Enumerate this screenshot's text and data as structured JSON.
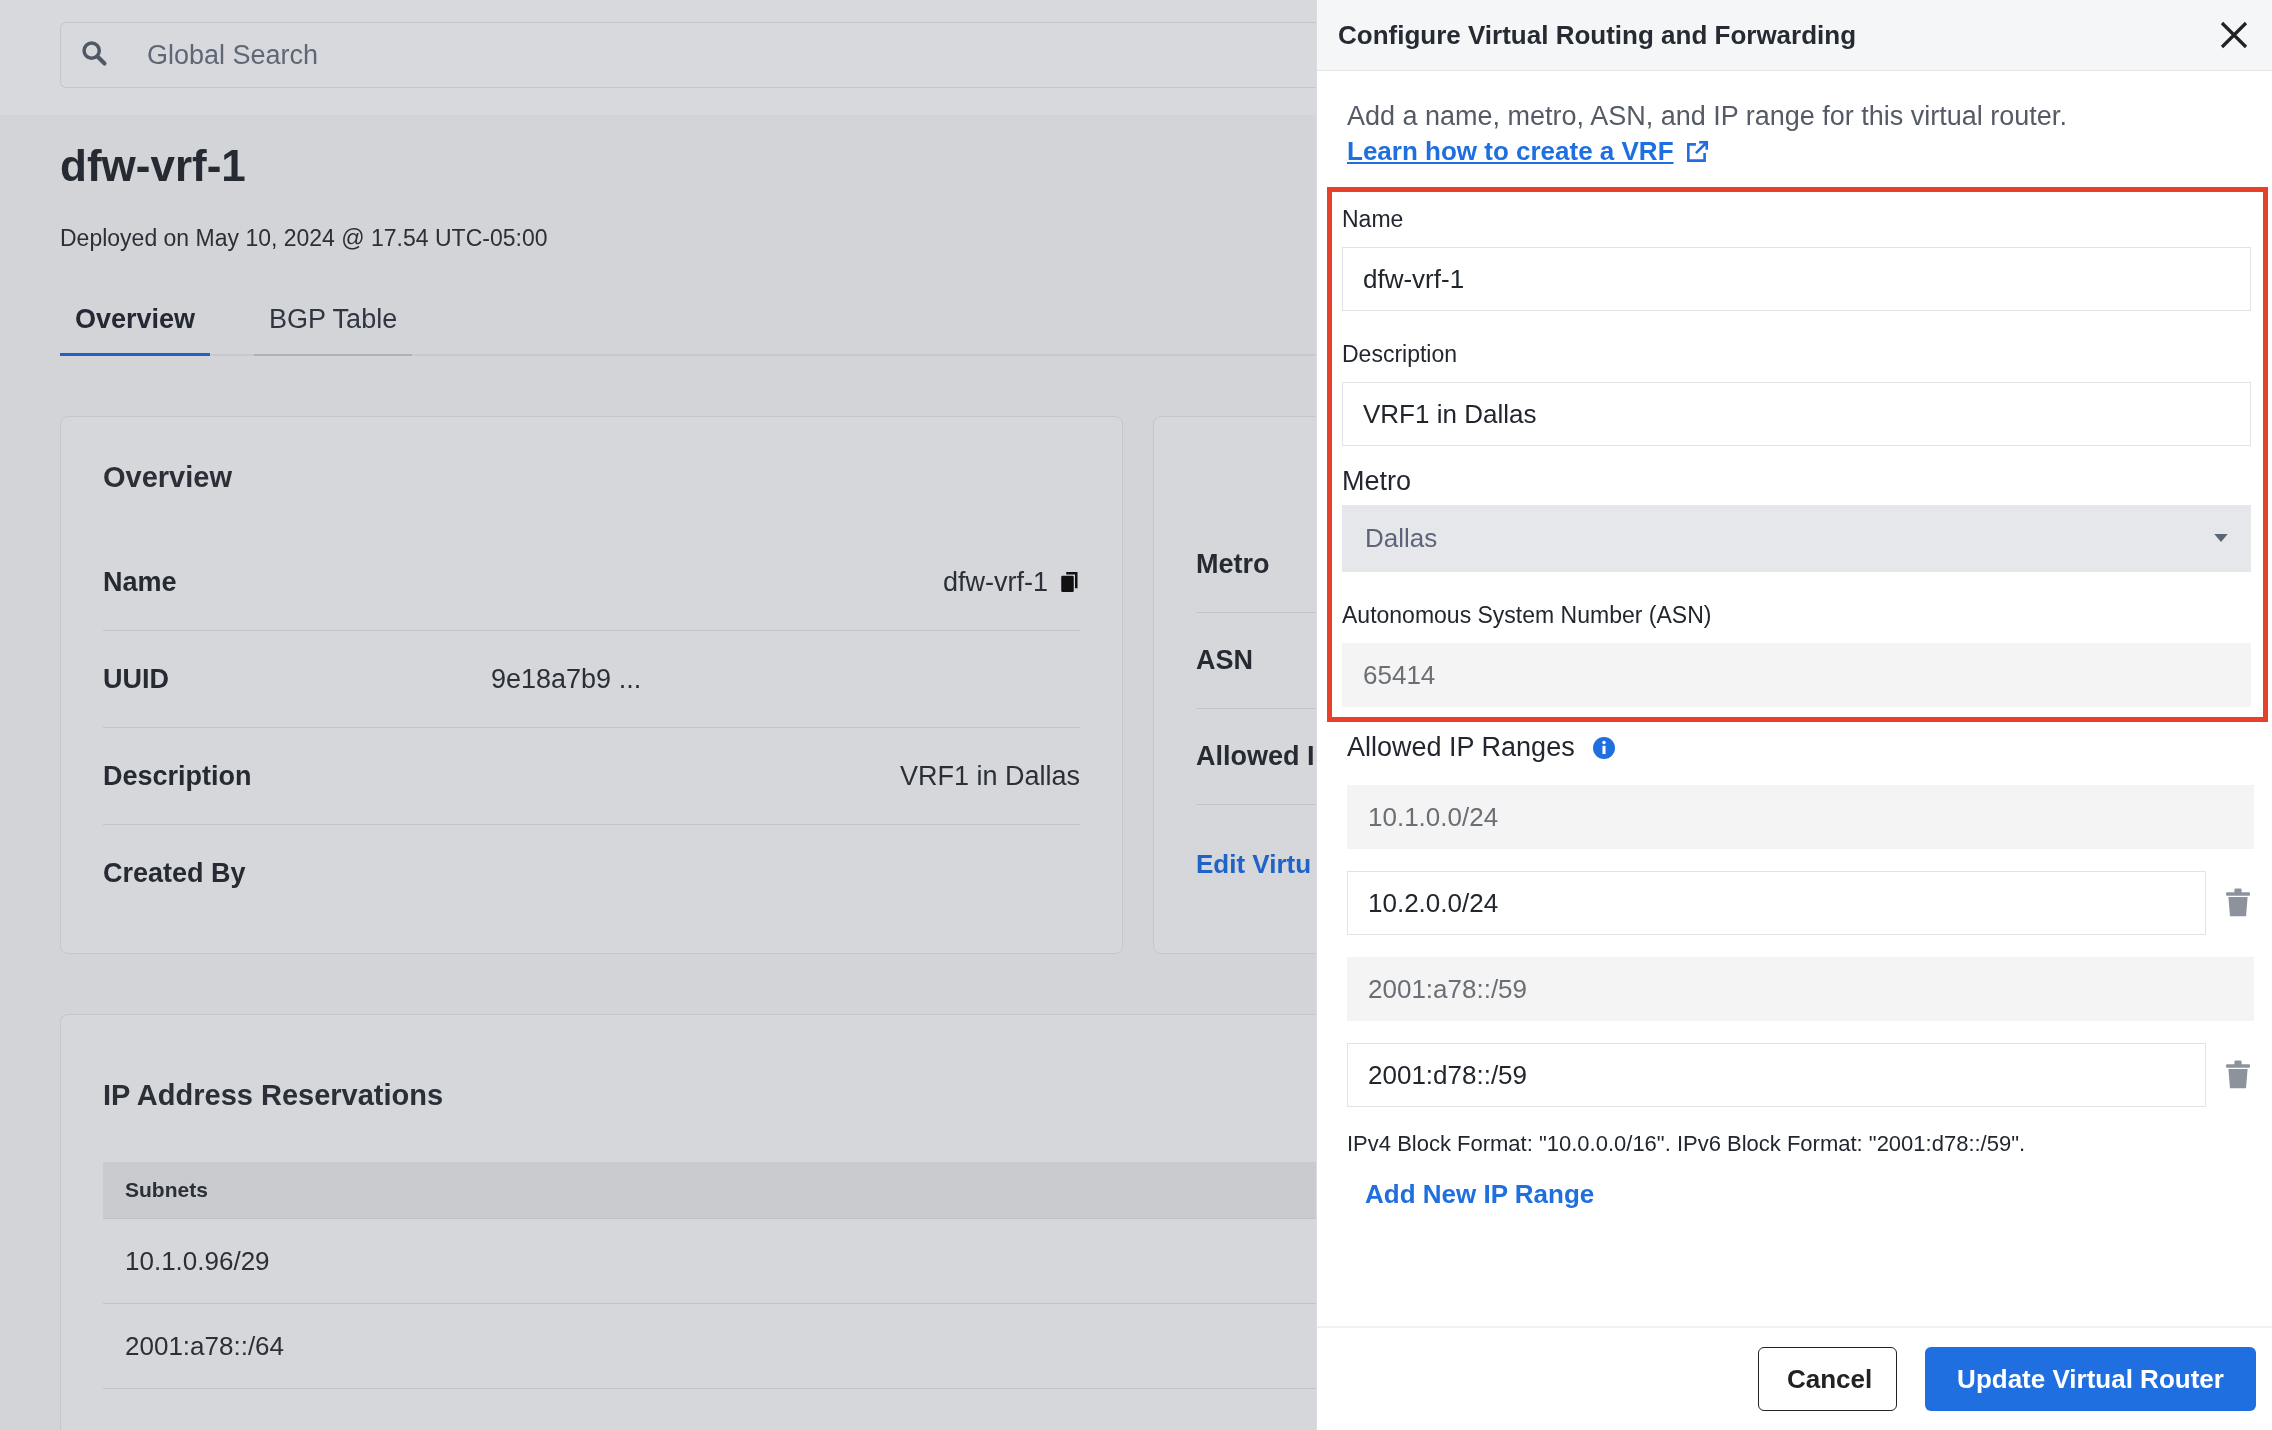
{
  "search": {
    "placeholder": "Global Search"
  },
  "page": {
    "title": "dfw-vrf-1",
    "subtitle": "Deployed on May 10, 2024 @ 17.54 UTC-05:00"
  },
  "tabs": [
    {
      "label": "Overview",
      "selected": true
    },
    {
      "label": "BGP Table",
      "selected": false
    }
  ],
  "overview_card": {
    "title": "Overview",
    "rows": [
      {
        "label": "Name",
        "value": "dfw-vrf-1",
        "kind": "value",
        "copyable": true
      },
      {
        "label": "UUID",
        "value": "9e18a7b9 ...",
        "kind": "id",
        "copyable": false
      },
      {
        "label": "Description",
        "value": "VRF1 in Dallas",
        "kind": "value",
        "copyable": false
      },
      {
        "label": "Created By",
        "kind": "empty",
        "copyable": false
      }
    ]
  },
  "details_card": {
    "rows": [
      {
        "label": "Metro"
      },
      {
        "label": "ASN"
      },
      {
        "label": "Allowed I"
      }
    ],
    "link": "Edit Virtu"
  },
  "reservations": {
    "title": "IP Address Reservations",
    "columns": [
      "Subnets"
    ],
    "rows": [
      "10.1.0.96/29",
      "2001:a78::/64"
    ]
  },
  "drawer": {
    "title": "Configure Virtual Routing and Forwarding",
    "intro": "Add a name, metro, ASN, and IP range for this virtual router.",
    "link": "Learn how to create a VRF",
    "highlighted_fields": [
      {
        "kind": "text",
        "label": "Name",
        "value": "dfw-vrf-1",
        "disabled": false
      },
      {
        "kind": "text",
        "label": "Description",
        "value": "VRF1 in Dallas",
        "disabled": false
      },
      {
        "kind": "select",
        "label": "Metro",
        "value": "Dallas",
        "disabled": true
      },
      {
        "kind": "text",
        "label": "Autonomous System Number (ASN)",
        "value": "65414",
        "disabled": true
      }
    ],
    "ip_ranges": {
      "label": "Allowed IP Ranges",
      "items": [
        {
          "value": "10.1.0.0/24",
          "disabled": true,
          "removable": false
        },
        {
          "value": "10.2.0.0/24",
          "disabled": false,
          "removable": true
        },
        {
          "value": "2001:a78::/59",
          "disabled": true,
          "removable": false
        },
        {
          "value": "2001:d78::/59",
          "disabled": false,
          "removable": true
        }
      ],
      "hint": "IPv4 Block Format: \"10.0.0.0/16\". IPv6 Block Format: \"2001:d78::/59\".",
      "add_link": "Add New IP Range"
    },
    "buttons": [
      {
        "label": "Cancel",
        "kind": "secondary"
      },
      {
        "label": "Update Virtual Router",
        "kind": "primary"
      }
    ]
  }
}
